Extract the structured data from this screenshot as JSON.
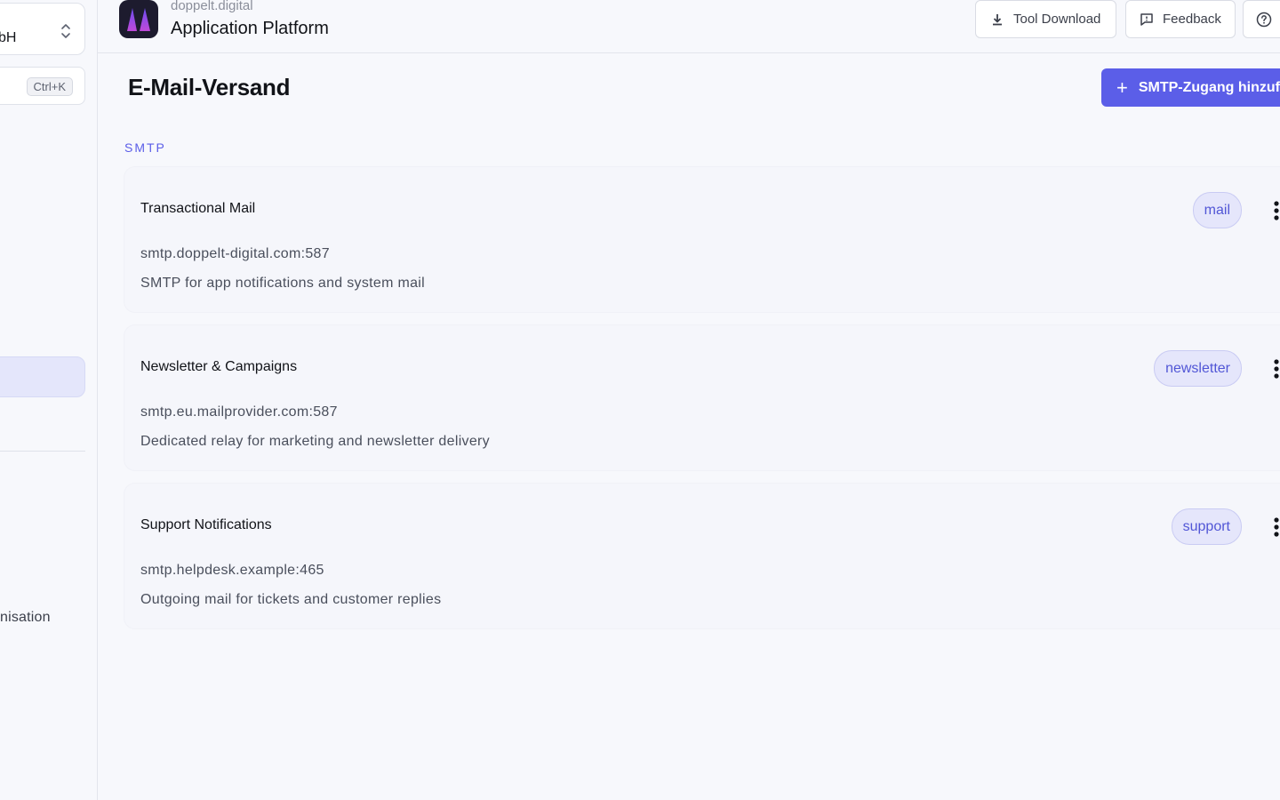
{
  "sidebar": {
    "org_name": "bH",
    "search_shortcut": "Ctrl+K",
    "org_item_label": "nisation"
  },
  "header": {
    "brand_small": "doppelt.digital",
    "brand_title": "Application Platform",
    "tool_download_label": "Tool Download",
    "feedback_label": "Feedback"
  },
  "main": {
    "title": "E-Mail-Versand",
    "add_button_label": "SMTP-Zugang hinzufü",
    "section_label": "SMTP",
    "entries": [
      {
        "name": "Transactional Mail",
        "host": "smtp.doppelt-digital.com:587",
        "description": "SMTP for app notifications and system mail",
        "tag": "mail"
      },
      {
        "name": "Newsletter & Campaigns",
        "host": "smtp.eu.mailprovider.com:587",
        "description": "Dedicated relay for marketing and newsletter delivery",
        "tag": "newsletter"
      },
      {
        "name": "Support Notifications",
        "host": "smtp.helpdesk.example:465",
        "description": "Outgoing mail for tickets and customer replies",
        "tag": "support"
      }
    ]
  },
  "colors": {
    "accent": "#5b5ee8",
    "background": "#f7f8fc",
    "tag_background": "#e5e6fb"
  },
  "icons": {
    "org_chevron": "chevron-up-down-icon",
    "download": "download-icon",
    "feedback": "feedback-icon",
    "help": "help-circle-icon",
    "add": "plus-icon",
    "more": "more-vertical-icon"
  }
}
